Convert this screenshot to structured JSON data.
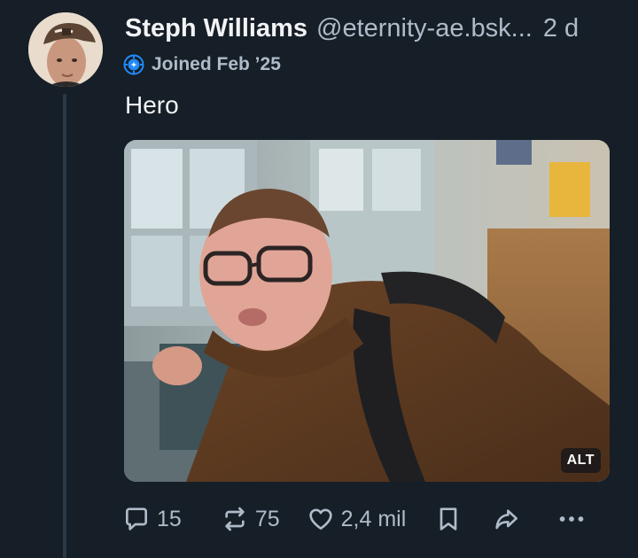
{
  "post": {
    "author": {
      "display_name": "Steph Williams",
      "handle": "@eternity-ae.bsk...",
      "joined": "Joined Feb ’25",
      "badge_icon": "new-account-icon",
      "accent_color": "#208bfe"
    },
    "time_ago": "2 d",
    "text": "Hero",
    "media": {
      "alt_label": "ALT"
    },
    "actions": {
      "replies": "15",
      "reposts": "75",
      "likes": "2,4 mil"
    }
  },
  "colors": {
    "background": "#161e27",
    "text_primary": "#f1f3f5",
    "text_secondary": "#aebbc9",
    "thread_line": "#2b3947"
  }
}
